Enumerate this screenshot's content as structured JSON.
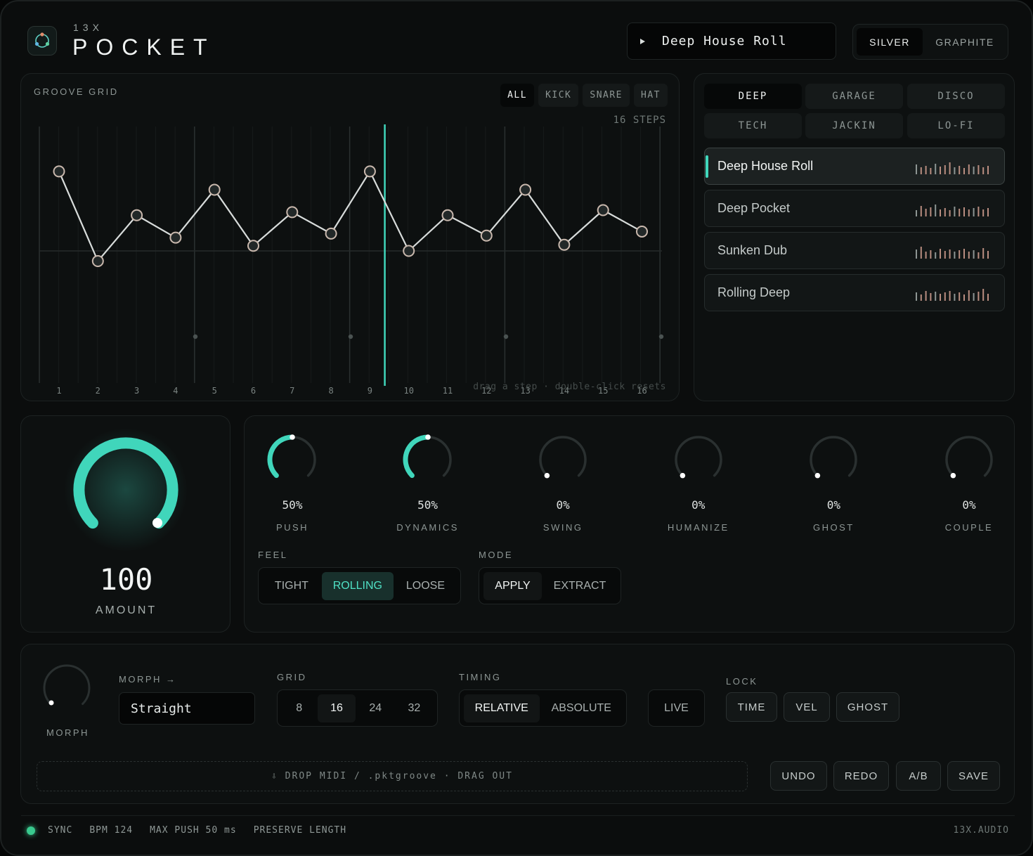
{
  "header": {
    "brand_prefix": "13X",
    "brand_name": "POCKET",
    "current_preset": "Deep House Roll",
    "themes": [
      "SILVER",
      "GRAPHITE"
    ],
    "active_theme": "SILVER"
  },
  "groove_grid": {
    "title": "GROOVE GRID",
    "filters": [
      "ALL",
      "KICK",
      "SNARE",
      "HAT"
    ],
    "active_filter": "ALL",
    "steps_label": "16 STEPS",
    "step_numbers": [
      "1",
      "2",
      "3",
      "4",
      "5",
      "6",
      "7",
      "8",
      "9",
      "10",
      "11",
      "12",
      "13",
      "14",
      "15",
      "16"
    ],
    "step_offsets": [
      0.78,
      -0.1,
      0.35,
      0.13,
      0.6,
      0.05,
      0.38,
      0.17,
      0.78,
      0.0,
      0.35,
      0.15,
      0.6,
      0.06,
      0.4,
      0.19
    ],
    "playhead_step": 8.6,
    "hint": "drag a step · double-click resets"
  },
  "styles": {
    "tabs": [
      "DEEP",
      "GARAGE",
      "DISCO",
      "TECH",
      "JACKIN",
      "LO-FI"
    ],
    "active": "DEEP"
  },
  "presets": [
    {
      "name": "Deep House Roll",
      "active": true
    },
    {
      "name": "Deep Pocket",
      "active": false
    },
    {
      "name": "Sunken Dub",
      "active": false
    },
    {
      "name": "Rolling Deep",
      "active": false
    }
  ],
  "amount": {
    "value": "100",
    "label": "AMOUNT"
  },
  "knobs": [
    {
      "value": "50%",
      "label": "PUSH",
      "level": 0.5
    },
    {
      "value": "50%",
      "label": "DYNAMICS",
      "level": 0.5
    },
    {
      "value": "0%",
      "label": "SWING",
      "level": 0
    },
    {
      "value": "0%",
      "label": "HUMANIZE",
      "level": 0
    },
    {
      "value": "0%",
      "label": "GHOST",
      "level": 0
    },
    {
      "value": "0%",
      "label": "COUPLE",
      "level": 0
    }
  ],
  "feel": {
    "label": "FEEL",
    "options": [
      "TIGHT",
      "ROLLING",
      "LOOSE"
    ],
    "active": "ROLLING"
  },
  "mode": {
    "label": "MODE",
    "options": [
      "APPLY",
      "EXTRACT"
    ],
    "active": "APPLY"
  },
  "bottom": {
    "morph_label": "MORPH",
    "morph_arrow_label": "MORPH →",
    "morph_value": "Straight",
    "grid_label": "GRID",
    "grid_options": [
      "8",
      "16",
      "24",
      "32"
    ],
    "grid_active": "16",
    "timing_label": "TIMING",
    "timing_options": [
      "RELATIVE",
      "ABSOLUTE"
    ],
    "timing_active": "RELATIVE",
    "live_label": "LIVE",
    "lock_label": "LOCK",
    "lock_options": [
      "TIME",
      "VEL",
      "GHOST"
    ],
    "dropzone": "⇩  DROP MIDI / .pktgroove  ·  DRAG OUT",
    "actions": [
      "UNDO",
      "REDO",
      "A/B",
      "SAVE"
    ]
  },
  "status": {
    "sync": "SYNC",
    "bpm": "BPM 124",
    "max_push": "MAX PUSH 50 ms",
    "preserve": "PRESERVE LENGTH",
    "site": "13X.AUDIO"
  },
  "colors": {
    "accent": "#40d6bb",
    "background": "#0b0d0d",
    "panel": "#0d1010"
  }
}
